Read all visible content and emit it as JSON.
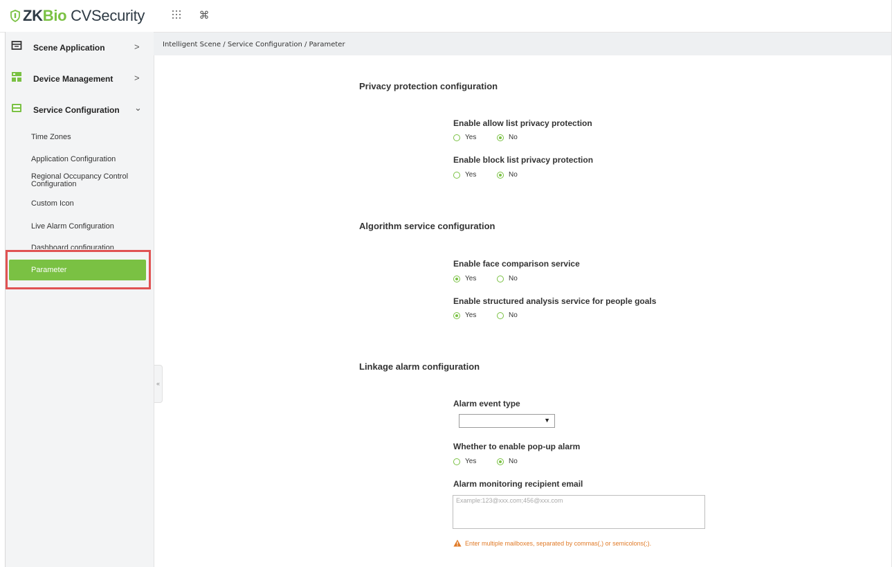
{
  "app": {
    "brand_zk": "ZK",
    "brand_bio": "Bio",
    "brand_rest": " CVSecurity",
    "accent_color": "#7ac143"
  },
  "topbar": {
    "apps_icon": "grid-dots-icon",
    "command_icon": "command-icon"
  },
  "sidebar": {
    "menus": [
      {
        "label": "Scene Application",
        "icon": "scene-icon",
        "chevron": ">"
      },
      {
        "label": "Device Management",
        "icon": "device-icon",
        "chevron": ">"
      },
      {
        "label": "Service Configuration",
        "icon": "service-icon",
        "chevron": "⌄"
      }
    ],
    "sub_items": [
      {
        "label": "Time Zones"
      },
      {
        "label": "Application Configuration"
      },
      {
        "label": "Regional Occupancy Control Configuration"
      },
      {
        "label": "Custom Icon"
      },
      {
        "label": "Live Alarm Configuration"
      },
      {
        "label": "Dashboard configuration"
      },
      {
        "label": "Parameter"
      }
    ],
    "collapse_label": "«"
  },
  "breadcrumb": "Intelligent Scene / Service Configuration / Parameter",
  "sections": {
    "privacy": {
      "title": "Privacy protection configuration",
      "allow_list": {
        "label": "Enable allow list privacy protection",
        "yes": "Yes",
        "no": "No",
        "value": "No"
      },
      "block_list": {
        "label": "Enable block list privacy protection",
        "yes": "Yes",
        "no": "No",
        "value": "No"
      }
    },
    "algorithm": {
      "title": "Algorithm service configuration",
      "face": {
        "label": "Enable face comparison service",
        "yes": "Yes",
        "no": "No",
        "value": "Yes"
      },
      "structured": {
        "label": "Enable structured analysis service for people goals",
        "yes": "Yes",
        "no": "No",
        "value": "Yes"
      }
    },
    "linkage": {
      "title": "Linkage alarm configuration",
      "event_type": {
        "label": "Alarm event type",
        "value": ""
      },
      "popup": {
        "label": "Whether to enable pop-up alarm",
        "yes": "Yes",
        "no": "No",
        "value": "No"
      },
      "email": {
        "label": "Alarm monitoring recipient email",
        "placeholder": "Example:123@xxx.com;456@xxx.com",
        "value": "",
        "hint": "Enter multiple mailboxes, separated by commas(,) or semicolons(;)."
      }
    }
  }
}
